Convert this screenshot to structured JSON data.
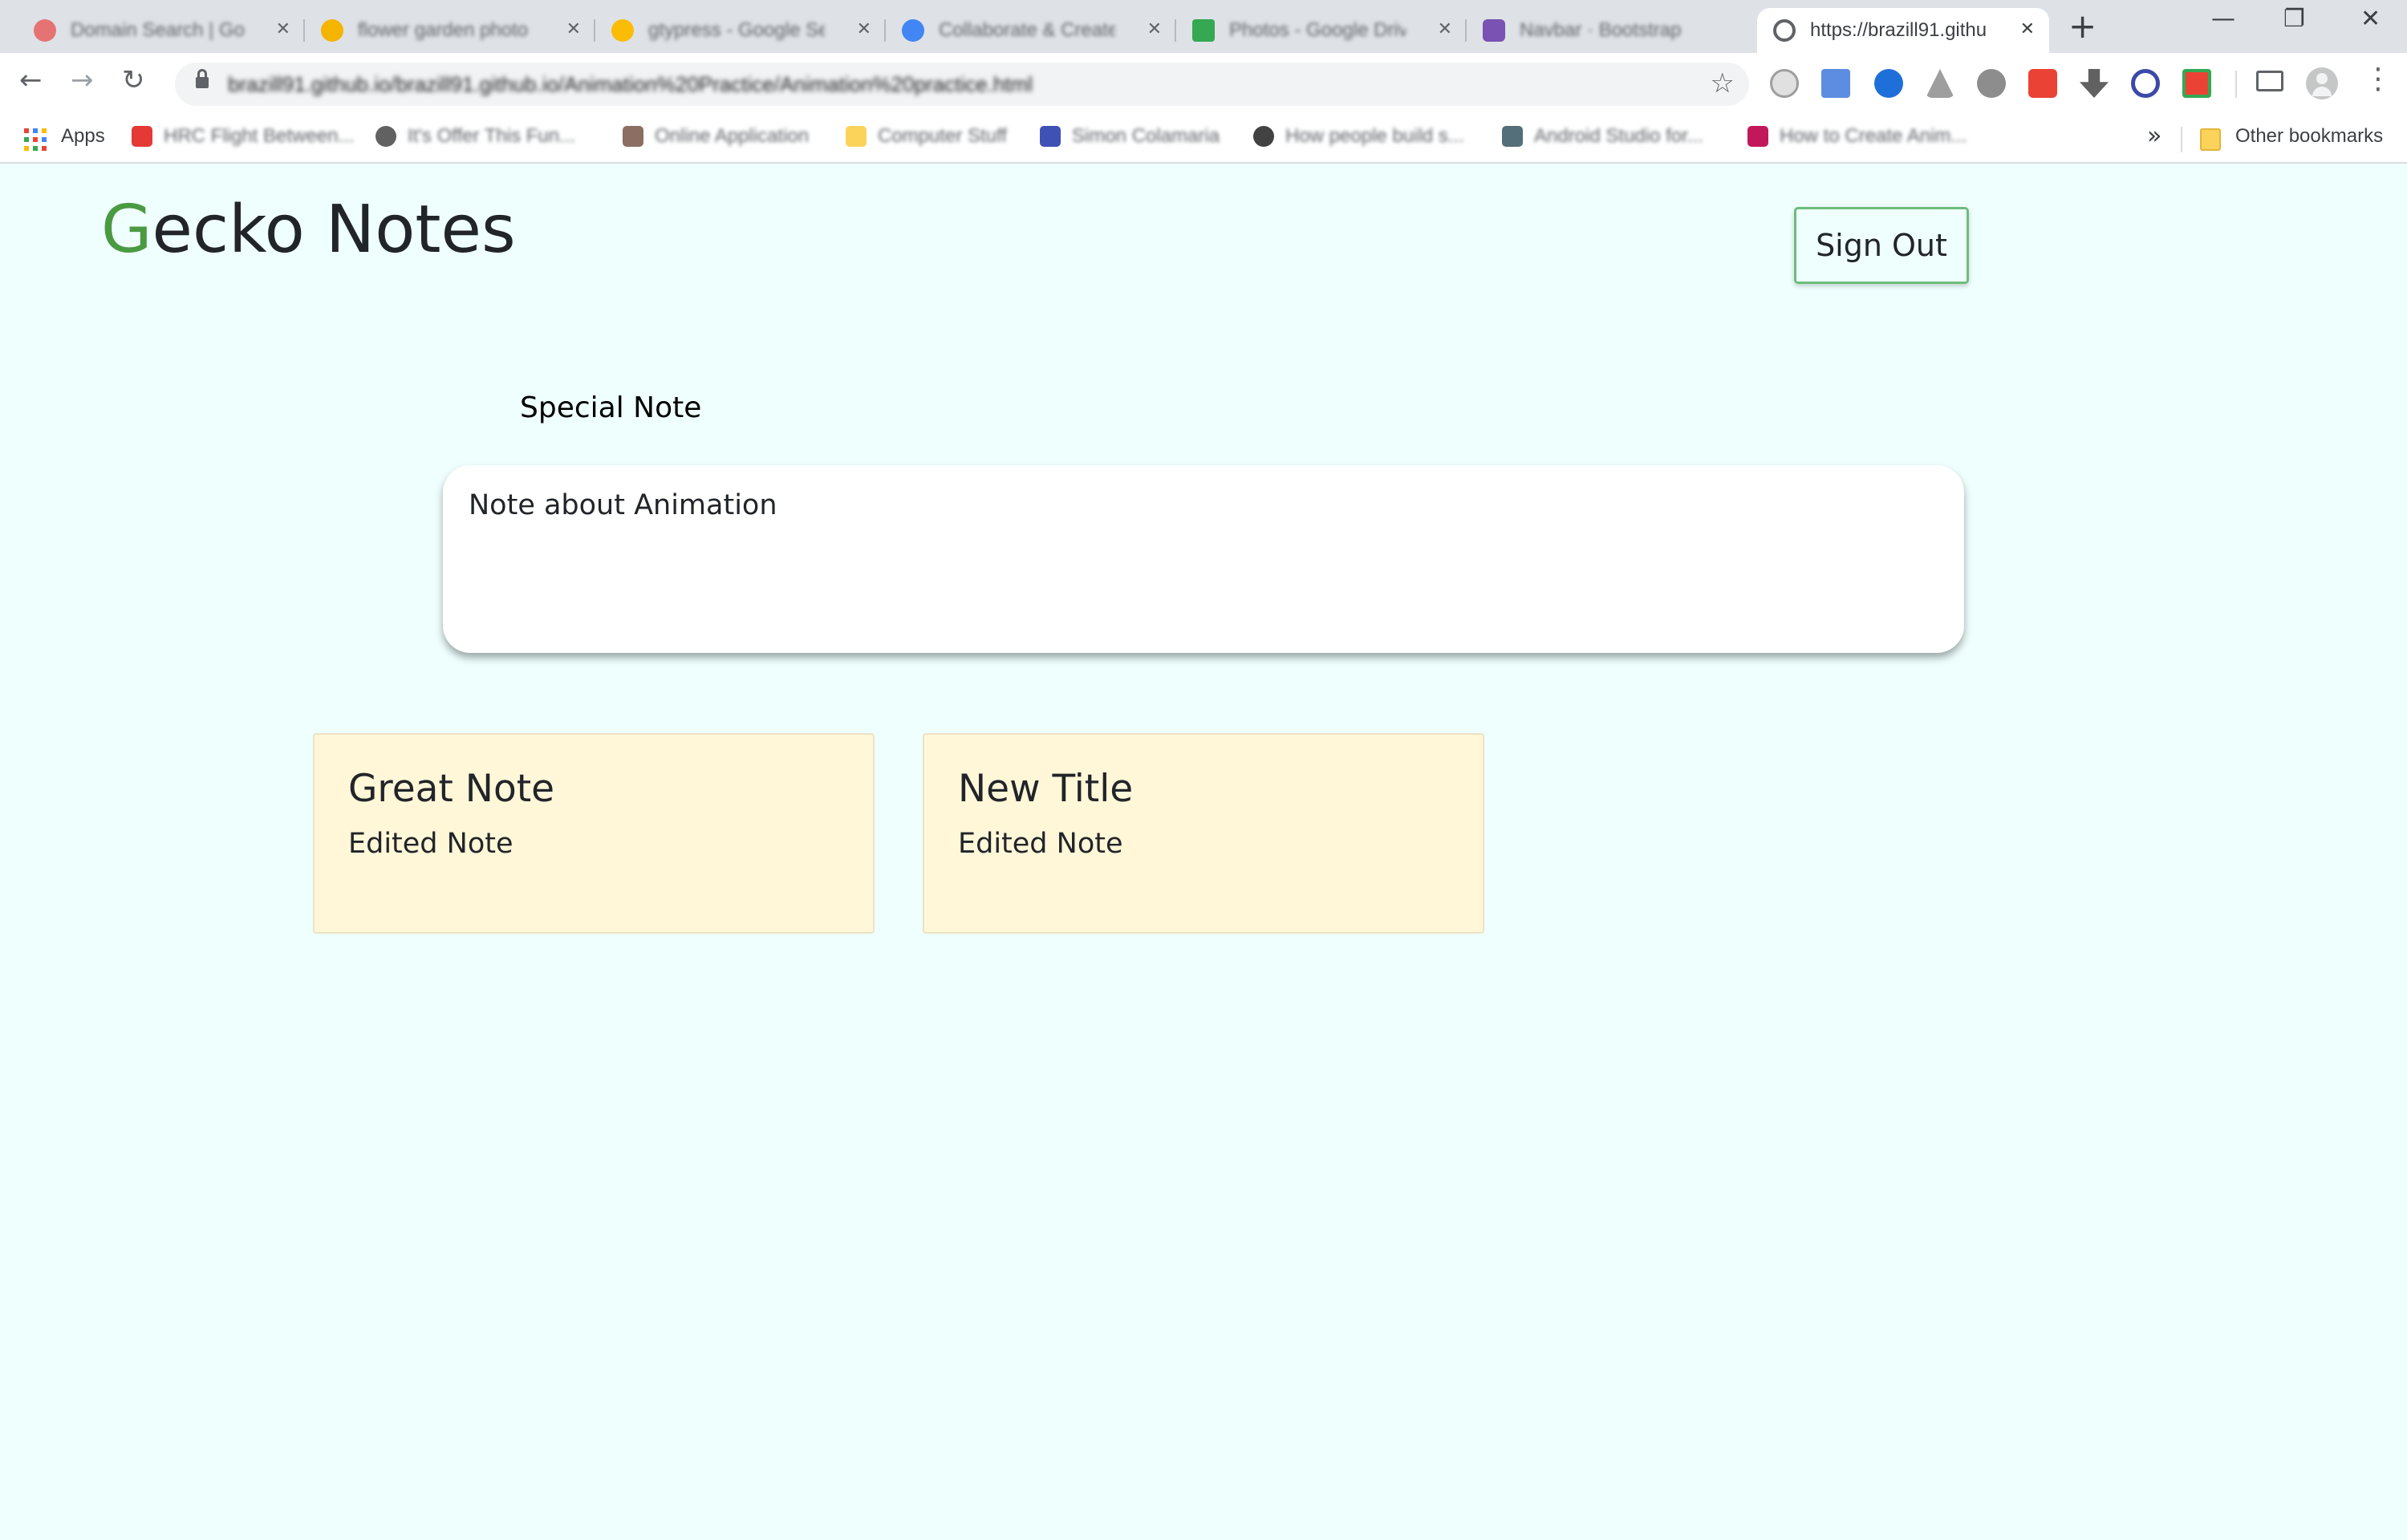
{
  "browser": {
    "tabs": [
      {
        "title": "Domain Search | Go",
        "favicon_color": "#e57373"
      },
      {
        "title": "flower garden photo",
        "favicon_color": "#f4b400"
      },
      {
        "title": "gtypress - Google Se",
        "favicon_color": "#fbbc05"
      },
      {
        "title": "Collaborate & Create",
        "favicon_color": "#4285f4"
      },
      {
        "title": "Photos - Google Drive",
        "favicon_color": "#34a853"
      },
      {
        "title": "Navbar · Bootstrap",
        "favicon_color": "#7952b3"
      },
      {
        "title": "https://brazill91.githu",
        "favicon_color": "#5f6368"
      }
    ],
    "new_tab_symbol": "+",
    "window_controls": {
      "minimize": "—",
      "restore": "❐",
      "close": "✕"
    },
    "url": "brazill91.github.io/brazill91.github.io/Animation%20Practice/Animation%20practice.html",
    "bookmarks": {
      "apps_label": "Apps",
      "items": [
        {
          "label": "HRC Flight Between...",
          "color": "#e53935"
        },
        {
          "label": "It's Offer This Fun...",
          "color": "#616161"
        },
        {
          "label": "Online Application",
          "color": "#8d6e63"
        },
        {
          "label": "Computer Stuff",
          "color": "#fbd35a"
        },
        {
          "label": "Simon Colamaria",
          "color": "#3f51b5"
        },
        {
          "label": "How people build s...",
          "color": "#424242"
        },
        {
          "label": "Android Studio for...",
          "color": "#546e7a"
        },
        {
          "label": "How to Create Anim...",
          "color": "#c2185b"
        }
      ],
      "overflow_symbol": "»",
      "other_bookmarks_label": "Other bookmarks"
    }
  },
  "app": {
    "logo_first_letter": "G",
    "logo_rest": "ecko Notes",
    "sign_out_label": "Sign Out",
    "special_note": {
      "title": "Special Note",
      "body": "Note about Animation"
    },
    "notes": [
      {
        "title": "Great Note",
        "body": "Edited Note"
      },
      {
        "title": "New Title",
        "body": "Edited Note"
      }
    ],
    "colors": {
      "page_background": "#effffe",
      "logo_accent": "#4a9a42",
      "card_background": "#fff7d8",
      "sign_out_border": "#6dbd7a"
    }
  }
}
